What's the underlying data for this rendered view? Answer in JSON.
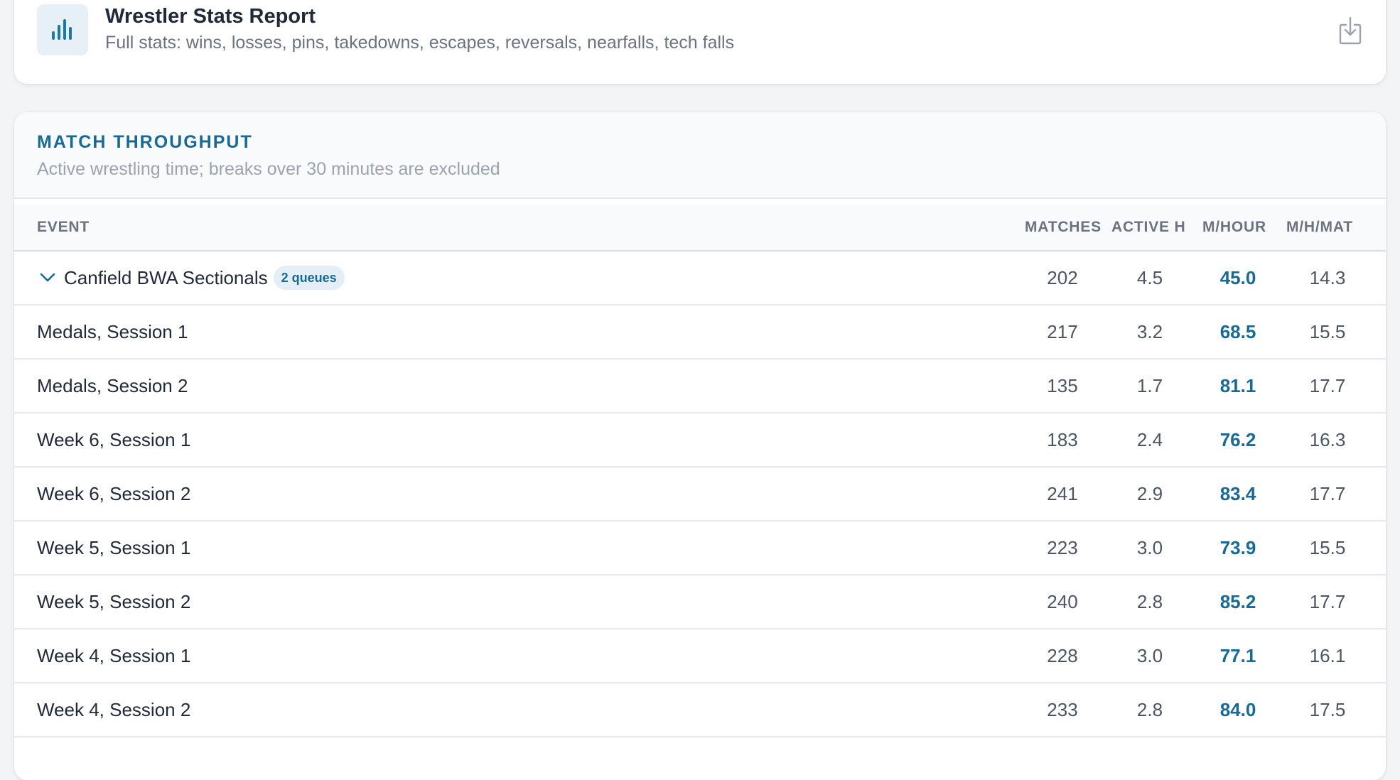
{
  "report": {
    "title": "Wrestler Stats Report",
    "subtitle": "Full stats: wins, losses, pins, takedowns, escapes, reversals, nearfalls, tech falls",
    "icon": "bar-chart-icon",
    "action_icon": "download-icon"
  },
  "throughput": {
    "title": "MATCH THROUGHPUT",
    "subtitle": "Active wrestling time; breaks over 30 minutes are excluded",
    "columns": {
      "event": "EVENT",
      "matches": "MATCHES",
      "active_h": "ACTIVE H",
      "m_hour": "M/HOUR",
      "m_h_mat": "M/H/MAT"
    },
    "rows": [
      {
        "event": "Canfield BWA Sectionals",
        "badge": "2 queues",
        "expandable": true,
        "matches": "202",
        "active_h": "4.5",
        "m_hour": "45.0",
        "m_h_mat": "14.3"
      },
      {
        "event": "Medals, Session 1",
        "badge": "",
        "expandable": false,
        "matches": "217",
        "active_h": "3.2",
        "m_hour": "68.5",
        "m_h_mat": "15.5"
      },
      {
        "event": "Medals, Session 2",
        "badge": "",
        "expandable": false,
        "matches": "135",
        "active_h": "1.7",
        "m_hour": "81.1",
        "m_h_mat": "17.7"
      },
      {
        "event": "Week 6, Session 1",
        "badge": "",
        "expandable": false,
        "matches": "183",
        "active_h": "2.4",
        "m_hour": "76.2",
        "m_h_mat": "16.3"
      },
      {
        "event": "Week 6, Session 2",
        "badge": "",
        "expandable": false,
        "matches": "241",
        "active_h": "2.9",
        "m_hour": "83.4",
        "m_h_mat": "17.7"
      },
      {
        "event": "Week 5, Session 1",
        "badge": "",
        "expandable": false,
        "matches": "223",
        "active_h": "3.0",
        "m_hour": "73.9",
        "m_h_mat": "15.5"
      },
      {
        "event": "Week 5, Session 2",
        "badge": "",
        "expandable": false,
        "matches": "240",
        "active_h": "2.8",
        "m_hour": "85.2",
        "m_h_mat": "17.7"
      },
      {
        "event": "Week 4, Session 1",
        "badge": "",
        "expandable": false,
        "matches": "228",
        "active_h": "3.0",
        "m_hour": "77.1",
        "m_h_mat": "16.1"
      },
      {
        "event": "Week 4, Session 2",
        "badge": "",
        "expandable": false,
        "matches": "233",
        "active_h": "2.8",
        "m_hour": "84.0",
        "m_h_mat": "17.5"
      }
    ]
  },
  "colors": {
    "accent": "#176a96",
    "badge_bg": "#e3eef6",
    "icon_bg": "#e7f0f6"
  }
}
